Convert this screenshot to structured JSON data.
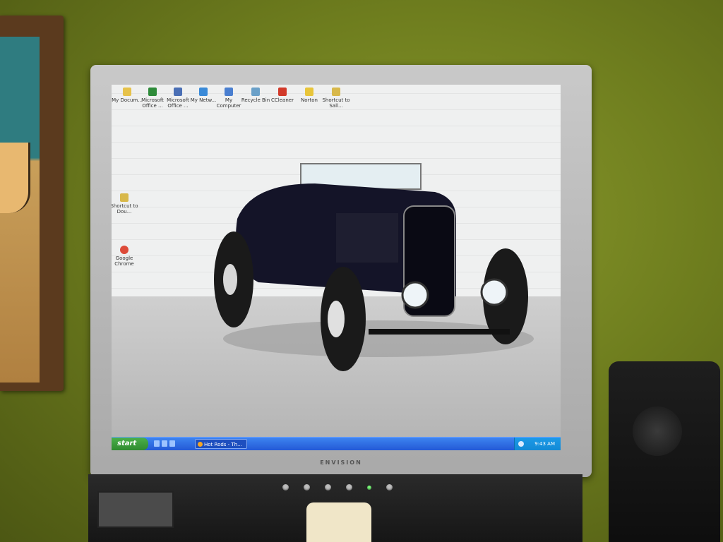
{
  "desktop": {
    "icons_top": [
      {
        "label": "My Docum...",
        "icon": "folder-icon",
        "color": "#e6c24a"
      },
      {
        "label": "Microsoft Office ...",
        "icon": "excel-icon",
        "color": "#2e8b3a"
      },
      {
        "label": "Microsoft Office ...",
        "icon": "office-icon",
        "color": "#4a6fb5"
      },
      {
        "label": "My Netw...",
        "icon": "network-icon",
        "color": "#3a8ad8"
      },
      {
        "label": "My Computer",
        "icon": "computer-icon",
        "color": "#4a7fd0"
      },
      {
        "label": "Recycle Bin",
        "icon": "recycle-bin-icon",
        "color": "#6aa0c8"
      },
      {
        "label": "CCleaner",
        "icon": "ccleaner-icon",
        "color": "#d23a2a"
      },
      {
        "label": "Norton",
        "icon": "norton-icon",
        "color": "#e8c53a"
      },
      {
        "label": "Shortcut to Sall...",
        "icon": "shortcut-icon",
        "color": "#d8b84a"
      }
    ],
    "icons_left": [
      {
        "label": "Shortcut to Dou...",
        "icon": "shortcut-icon",
        "color": "#d8b84a"
      },
      {
        "label": "Google Chrome",
        "icon": "chrome-icon",
        "color": "#dd4b39"
      }
    ]
  },
  "taskbar": {
    "start_label": "start",
    "task_label": "Hot Rods - Th...",
    "clock": "9:43 AM"
  },
  "monitor": {
    "brand": "ENVISION"
  },
  "colors": {
    "taskbar": "#2459d6",
    "start": "#2f8b2f",
    "tray": "#138ad5"
  }
}
